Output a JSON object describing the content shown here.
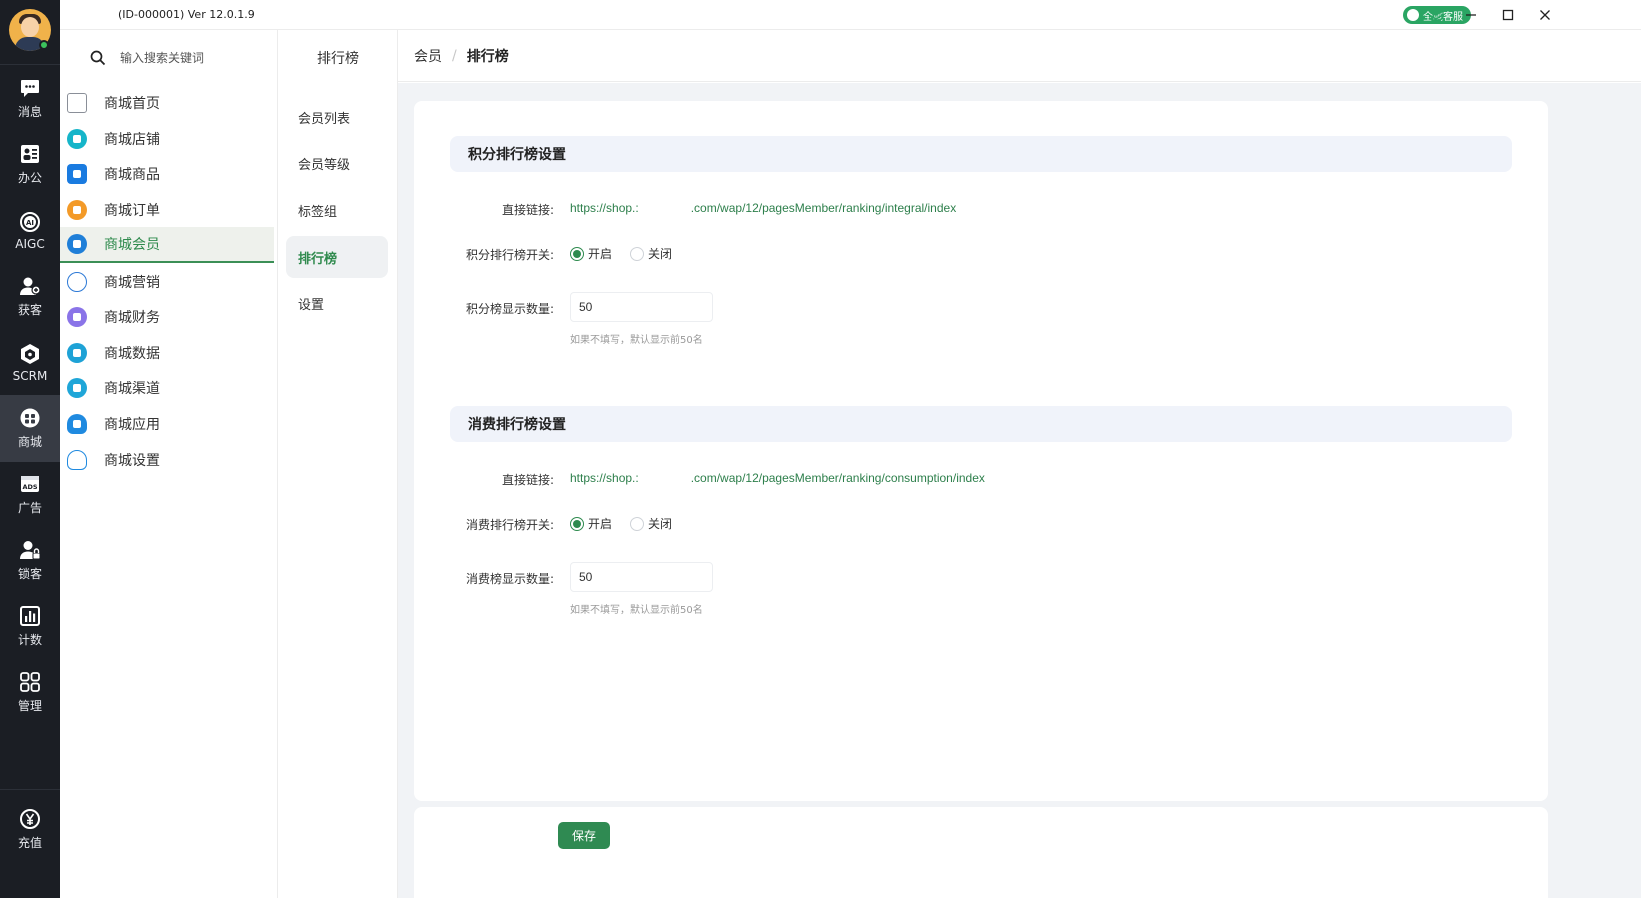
{
  "window": {
    "title": "(ID-000001)  Ver 12.0.1.9",
    "service_badge": "全域客服"
  },
  "rail": {
    "items": [
      {
        "label": "消息",
        "icon": "chat-icon"
      },
      {
        "label": "办公",
        "icon": "office-icon"
      },
      {
        "label": "AIGC",
        "icon": "ai-icon"
      },
      {
        "label": "获客",
        "icon": "user-add-icon"
      },
      {
        "label": "SCRM",
        "icon": "scrm-icon"
      },
      {
        "label": "商城",
        "icon": "store-icon",
        "active": true
      },
      {
        "label": "广告",
        "icon": "ads-icon"
      },
      {
        "label": "锁客",
        "icon": "user-lock-icon"
      },
      {
        "label": "计数",
        "icon": "bar-chart-icon"
      },
      {
        "label": "管理",
        "icon": "grid-icon"
      }
    ],
    "recharge": {
      "label": "充值",
      "icon": "yen-icon"
    }
  },
  "nav": {
    "search_placeholder": "输入搜索关键词",
    "items": [
      {
        "label": "商城首页",
        "icon": "home-icon",
        "color": "#8a8f98"
      },
      {
        "label": "商城店铺",
        "icon": "shop-icon",
        "color": "#16b5c9"
      },
      {
        "label": "商城商品",
        "icon": "bag-icon",
        "color": "#1a7be0"
      },
      {
        "label": "商城订单",
        "icon": "order-icon",
        "color": "#f39a28"
      },
      {
        "label": "商城会员",
        "icon": "members-icon",
        "color": "#1f7fd8",
        "active": true
      },
      {
        "label": "商城营销",
        "icon": "marketing-icon",
        "color": "#2c79d6"
      },
      {
        "label": "商城财务",
        "icon": "finance-icon",
        "color": "#8a74e8"
      },
      {
        "label": "商城数据",
        "icon": "data-icon",
        "color": "#1ea2d6"
      },
      {
        "label": "商城渠道",
        "icon": "channel-icon",
        "color": "#1fa6d8"
      },
      {
        "label": "商城应用",
        "icon": "cloud-app-icon",
        "color": "#1f8ae0"
      },
      {
        "label": "商城设置",
        "icon": "cloud-settings-icon",
        "color": "#1f8ae0"
      }
    ]
  },
  "subnav": {
    "title": "排行榜",
    "items": [
      {
        "label": "会员列表"
      },
      {
        "label": "会员等级"
      },
      {
        "label": "标签组"
      },
      {
        "label": "排行榜",
        "active": true
      },
      {
        "label": "设置"
      }
    ]
  },
  "breadcrumb": {
    "parent": "会员",
    "sep": "/",
    "current": "排行榜"
  },
  "integral": {
    "title": "积分排行榜设置",
    "link_label": "直接链接:",
    "link_prefix": "https://shop.:",
    "link_suffix": ".com/wap/12/pagesMember/ranking/integral/index",
    "switch_label": "积分排行榜开关:",
    "on_label": "开启",
    "off_label": "关闭",
    "selected": "on",
    "count_label": "积分榜显示数量:",
    "count_value": "50",
    "hint": "如果不填写，默认显示前50名"
  },
  "consumption": {
    "title": "消费排行榜设置",
    "link_label": "直接链接:",
    "link_prefix": "https://shop.:",
    "link_suffix": ".com/wap/12/pagesMember/ranking/consumption/index",
    "switch_label": "消费排行榜开关:",
    "on_label": "开启",
    "off_label": "关闭",
    "selected": "on",
    "count_label": "消费榜显示数量:",
    "count_value": "50",
    "hint": "如果不填写，默认显示前50名"
  },
  "footer": {
    "save_label": "保存"
  },
  "colors": {
    "accent": "#2f8a52",
    "rail_bg": "#1b1e24",
    "content_bg": "#f1f3f6"
  }
}
